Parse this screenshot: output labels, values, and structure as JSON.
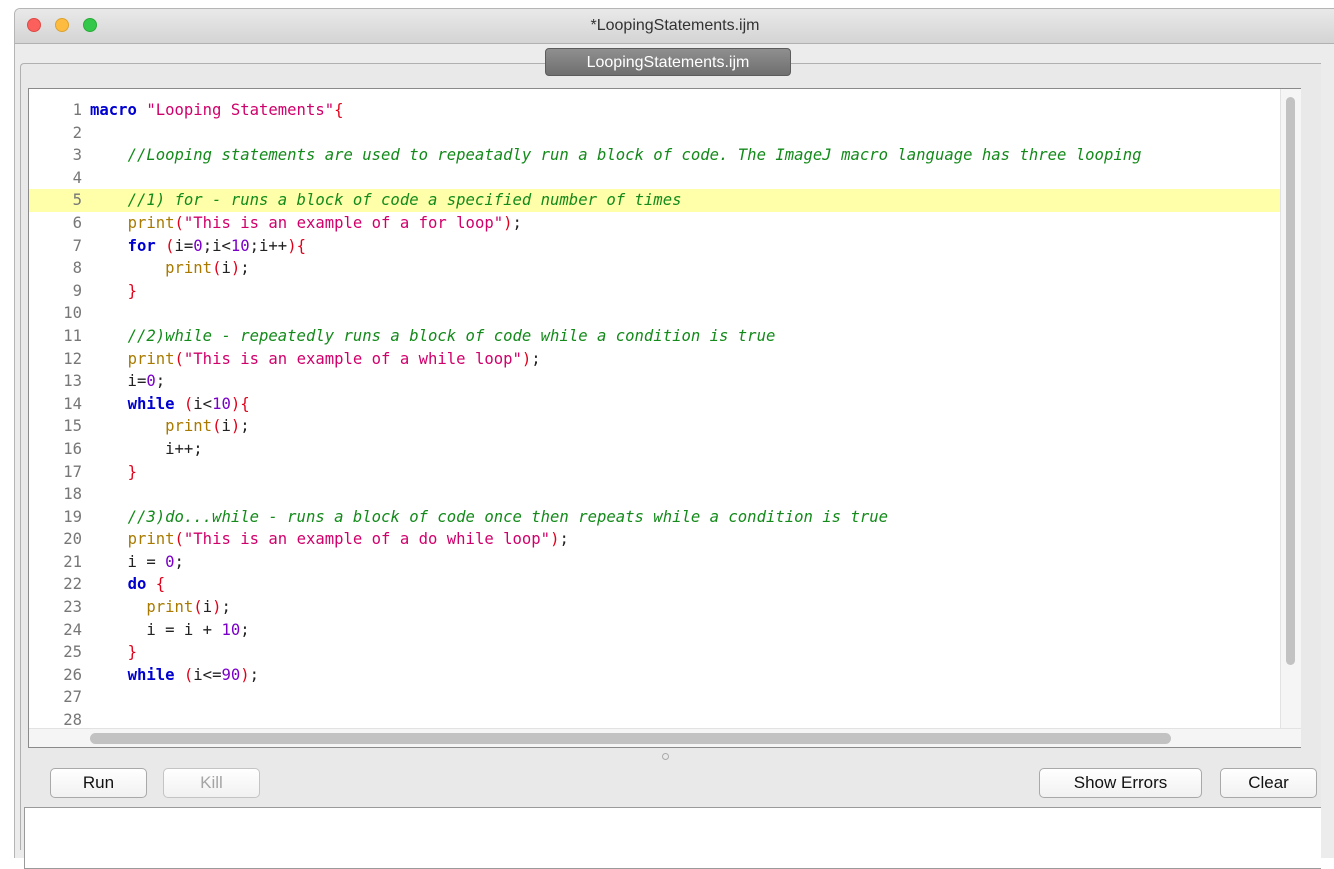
{
  "window": {
    "title": "*LoopingStatements.ijm",
    "tab_label": "LoopingStatements.ijm"
  },
  "editor": {
    "lines": [
      {
        "n": "1",
        "tokens": [
          [
            "kw",
            "macro"
          ],
          [
            "plain",
            " "
          ],
          [
            "str",
            "\"Looping Statements\""
          ],
          [
            "br",
            "{"
          ]
        ]
      },
      {
        "n": "2",
        "tokens": []
      },
      {
        "n": "3",
        "tokens": [
          [
            "plain",
            "    "
          ],
          [
            "cmt",
            "//Looping statements are used to repeatadly run a block of code. The ImageJ macro language has three looping"
          ]
        ]
      },
      {
        "n": "4",
        "tokens": []
      },
      {
        "n": "5",
        "hl": true,
        "tokens": [
          [
            "plain",
            "    "
          ],
          [
            "cmt",
            "//1) for - runs a block of code a specified number of times"
          ]
        ]
      },
      {
        "n": "6",
        "tokens": [
          [
            "plain",
            "    "
          ],
          [
            "fn",
            "print"
          ],
          [
            "br",
            "("
          ],
          [
            "str",
            "\"This is an example of a for loop\""
          ],
          [
            "br",
            ")"
          ],
          [
            "plain",
            ";"
          ]
        ]
      },
      {
        "n": "7",
        "tokens": [
          [
            "plain",
            "    "
          ],
          [
            "kw",
            "for"
          ],
          [
            "plain",
            " "
          ],
          [
            "br",
            "("
          ],
          [
            "plain",
            "i="
          ],
          [
            "num",
            "0"
          ],
          [
            "plain",
            ";i<"
          ],
          [
            "num",
            "10"
          ],
          [
            "plain",
            ";i++"
          ],
          [
            "br",
            ")"
          ],
          [
            "br",
            "{"
          ]
        ]
      },
      {
        "n": "8",
        "tokens": [
          [
            "plain",
            "        "
          ],
          [
            "fn",
            "print"
          ],
          [
            "br",
            "("
          ],
          [
            "plain",
            "i"
          ],
          [
            "br",
            ")"
          ],
          [
            "plain",
            ";"
          ]
        ]
      },
      {
        "n": "9",
        "tokens": [
          [
            "plain",
            "    "
          ],
          [
            "br",
            "}"
          ]
        ]
      },
      {
        "n": "10",
        "tokens": []
      },
      {
        "n": "11",
        "tokens": [
          [
            "plain",
            "    "
          ],
          [
            "cmt",
            "//2)while - repeatedly runs a block of code while a condition is true"
          ]
        ]
      },
      {
        "n": "12",
        "tokens": [
          [
            "plain",
            "    "
          ],
          [
            "fn",
            "print"
          ],
          [
            "br",
            "("
          ],
          [
            "str",
            "\"This is an example of a while loop\""
          ],
          [
            "br",
            ")"
          ],
          [
            "plain",
            ";"
          ]
        ]
      },
      {
        "n": "13",
        "tokens": [
          [
            "plain",
            "    i="
          ],
          [
            "num",
            "0"
          ],
          [
            "plain",
            ";"
          ]
        ]
      },
      {
        "n": "14",
        "tokens": [
          [
            "plain",
            "    "
          ],
          [
            "kw",
            "while"
          ],
          [
            "plain",
            " "
          ],
          [
            "br",
            "("
          ],
          [
            "plain",
            "i<"
          ],
          [
            "num",
            "10"
          ],
          [
            "br",
            ")"
          ],
          [
            "br",
            "{"
          ]
        ]
      },
      {
        "n": "15",
        "tokens": [
          [
            "plain",
            "        "
          ],
          [
            "fn",
            "print"
          ],
          [
            "br",
            "("
          ],
          [
            "plain",
            "i"
          ],
          [
            "br",
            ")"
          ],
          [
            "plain",
            ";"
          ]
        ]
      },
      {
        "n": "16",
        "tokens": [
          [
            "plain",
            "        i++;"
          ]
        ]
      },
      {
        "n": "17",
        "tokens": [
          [
            "plain",
            "    "
          ],
          [
            "br",
            "}"
          ]
        ]
      },
      {
        "n": "18",
        "tokens": []
      },
      {
        "n": "19",
        "tokens": [
          [
            "plain",
            "    "
          ],
          [
            "cmt",
            "//3)do...while - runs a block of code once then repeats while a condition is true"
          ]
        ]
      },
      {
        "n": "20",
        "tokens": [
          [
            "plain",
            "    "
          ],
          [
            "fn",
            "print"
          ],
          [
            "br",
            "("
          ],
          [
            "str",
            "\"This is an example of a do while loop\""
          ],
          [
            "br",
            ")"
          ],
          [
            "plain",
            ";"
          ]
        ]
      },
      {
        "n": "21",
        "tokens": [
          [
            "plain",
            "    i = "
          ],
          [
            "num",
            "0"
          ],
          [
            "plain",
            ";"
          ]
        ]
      },
      {
        "n": "22",
        "tokens": [
          [
            "plain",
            "    "
          ],
          [
            "kw",
            "do"
          ],
          [
            "plain",
            " "
          ],
          [
            "br",
            "{"
          ]
        ]
      },
      {
        "n": "23",
        "tokens": [
          [
            "plain",
            "      "
          ],
          [
            "fn",
            "print"
          ],
          [
            "br",
            "("
          ],
          [
            "plain",
            "i"
          ],
          [
            "br",
            ")"
          ],
          [
            "plain",
            ";"
          ]
        ]
      },
      {
        "n": "24",
        "tokens": [
          [
            "plain",
            "      i = i + "
          ],
          [
            "num",
            "10"
          ],
          [
            "plain",
            ";"
          ]
        ]
      },
      {
        "n": "25",
        "tokens": [
          [
            "plain",
            "    "
          ],
          [
            "br",
            "}"
          ]
        ]
      },
      {
        "n": "26",
        "tokens": [
          [
            "plain",
            "    "
          ],
          [
            "kw",
            "while"
          ],
          [
            "plain",
            " "
          ],
          [
            "br",
            "("
          ],
          [
            "plain",
            "i<="
          ],
          [
            "num",
            "90"
          ],
          [
            "br",
            ")"
          ],
          [
            "plain",
            ";"
          ]
        ]
      },
      {
        "n": "27",
        "tokens": []
      },
      {
        "n": "28",
        "tokens": []
      }
    ]
  },
  "buttons": {
    "run": "Run",
    "kill": "Kill",
    "show_errors": "Show Errors",
    "clear": "Clear"
  }
}
